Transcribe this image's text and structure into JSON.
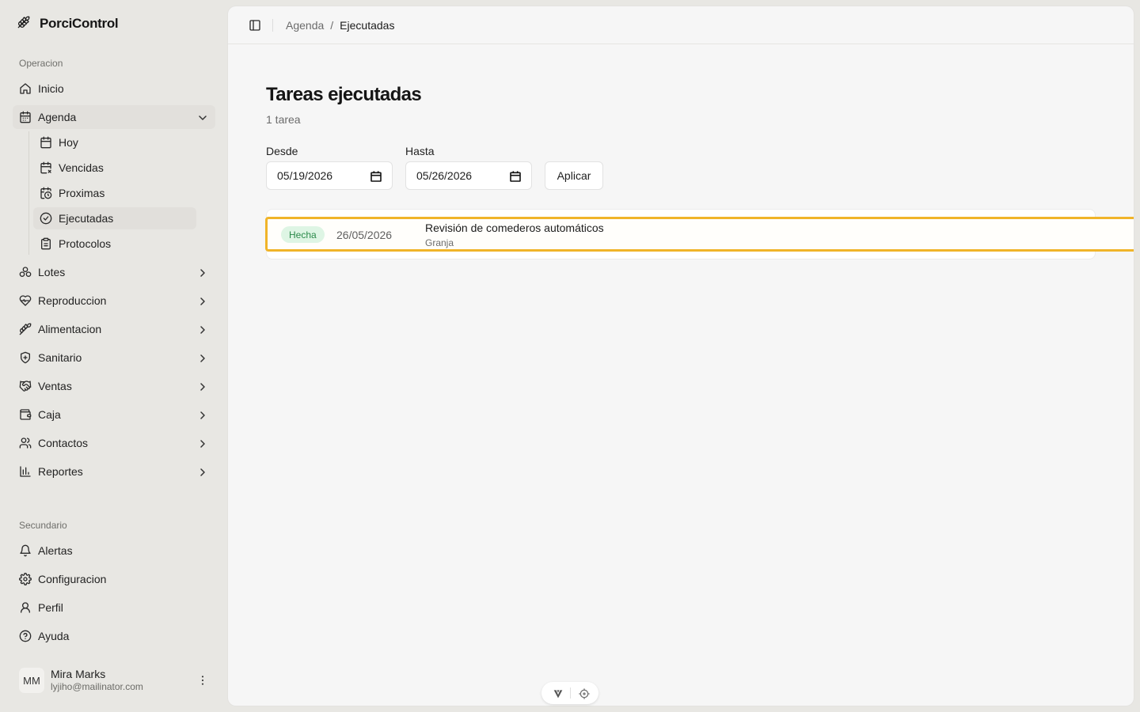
{
  "app": {
    "name": "PorciControl"
  },
  "sidebar": {
    "group_operacion": "Operacion",
    "inicio": "Inicio",
    "agenda": "Agenda",
    "agenda_children": {
      "hoy": "Hoy",
      "vencidas": "Vencidas",
      "proximas": "Proximas",
      "ejecutadas": "Ejecutadas",
      "protocolos": "Protocolos"
    },
    "lotes": "Lotes",
    "reproduccion": "Reproduccion",
    "alimentacion": "Alimentacion",
    "sanitario": "Sanitario",
    "ventas": "Ventas",
    "caja": "Caja",
    "contactos": "Contactos",
    "reportes": "Reportes",
    "group_secundario": "Secundario",
    "alertas": "Alertas",
    "configuracion": "Configuracion",
    "perfil": "Perfil",
    "ayuda": "Ayuda"
  },
  "user": {
    "initials": "MM",
    "name": "Mira Marks",
    "email": "lyjiho@mailinator.com"
  },
  "breadcrumb": {
    "parent": "Agenda",
    "separator": "/",
    "current": "Ejecutadas"
  },
  "page": {
    "title": "Tareas ejecutadas",
    "count_label": "1 tarea"
  },
  "filters": {
    "desde_label": "Desde",
    "desde_value": "05/19/2026",
    "hasta_label": "Hasta",
    "hasta_value": "05/26/2026",
    "apply_label": "Aplicar"
  },
  "tasks": [
    {
      "status": "Hecha",
      "date": "26/05/2026",
      "title": "Revisión de comederos automáticos",
      "location": "Granja"
    }
  ],
  "colors": {
    "accent_outline": "#f0b429",
    "status_done_bg": "#def5e4",
    "status_done_text": "#2b8a4a"
  }
}
